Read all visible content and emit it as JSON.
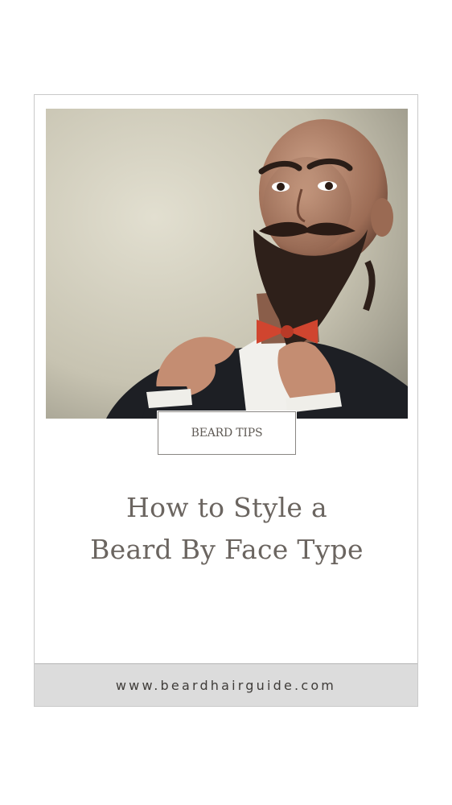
{
  "photo": {
    "icon": "bearded-man-with-bow-tie-photo",
    "background_color": "#ccc8b6",
    "bow_tie_color": "#d0452f"
  },
  "tag": {
    "label": "BEARD TIPS"
  },
  "headline": {
    "line1": "How to Style a",
    "line2": "Beard By Face Type"
  },
  "footer": {
    "url": "www.beardhairguide.com"
  }
}
